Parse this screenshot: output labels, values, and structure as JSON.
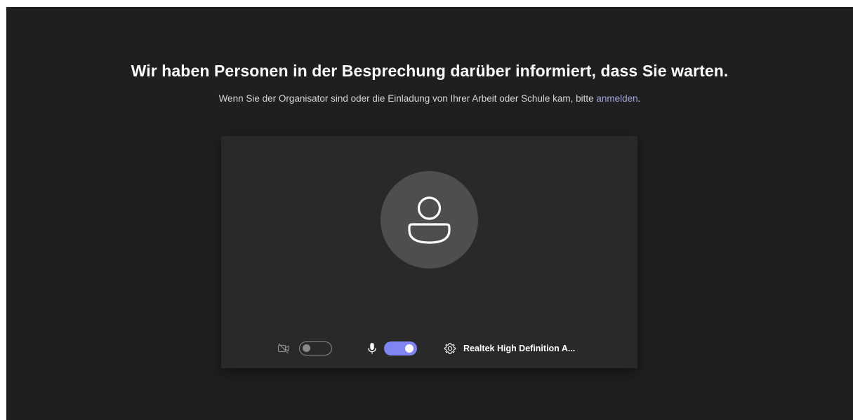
{
  "header": {
    "title": "Wir haben Personen in der Besprechung darüber informiert, dass Sie warten.",
    "subtitle_prefix": "Wenn Sie der Organisator sind oder die Einladung von Ihrer Arbeit oder Schule kam, bitte ",
    "signin_link": "anmelden",
    "subtitle_suffix": "."
  },
  "preview": {
    "avatar_icon": "person-icon"
  },
  "controls": {
    "camera": {
      "icon": "camera-off-icon",
      "enabled": false
    },
    "microphone": {
      "icon": "microphone-icon",
      "enabled": true
    },
    "audio_device": {
      "icon": "gear-icon",
      "label": "Realtek High Definition A..."
    }
  },
  "colors": {
    "background": "#1f1f1f",
    "preview_panel": "#292929",
    "avatar": "#4e4e4e",
    "accent": "#7f85f5",
    "link": "#a6a7dc"
  }
}
